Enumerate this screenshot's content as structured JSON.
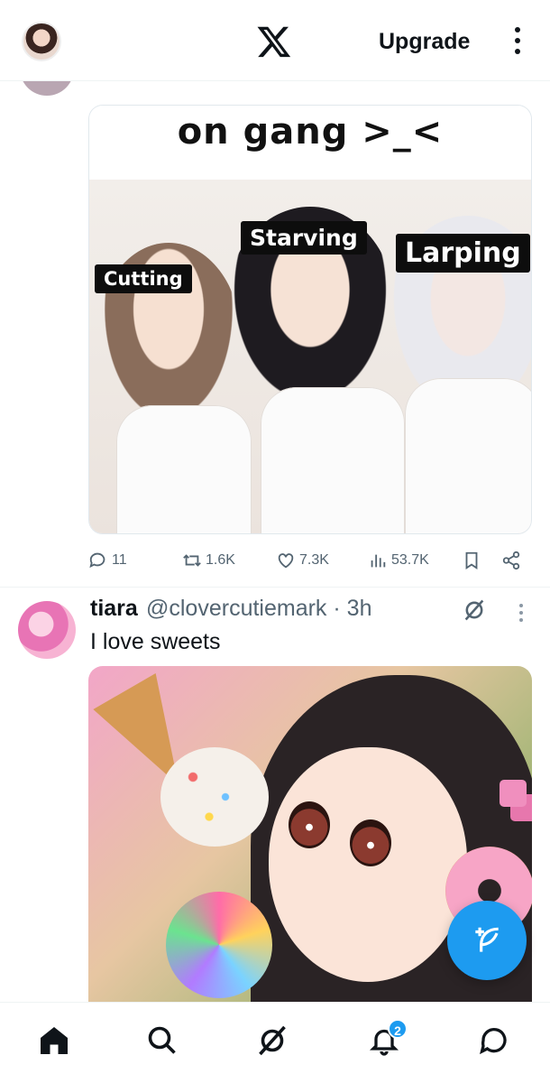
{
  "header": {
    "upgrade_label": "Upgrade"
  },
  "post1": {
    "meme_caption": "on gang >_<",
    "labels": [
      "Cutting",
      "Starving",
      "Larping"
    ],
    "stats": {
      "replies": "11",
      "reposts": "1.6K",
      "likes": "7.3K",
      "views": "53.7K"
    }
  },
  "post2": {
    "name": "tiara",
    "handle": "@clovercutiemark",
    "time": "· 3h",
    "text": "I love sweets"
  },
  "nav": {
    "notifications_badge": "2"
  },
  "colors": {
    "accent": "#1d9bf0",
    "text": "#0f1419",
    "muted": "#536471"
  }
}
